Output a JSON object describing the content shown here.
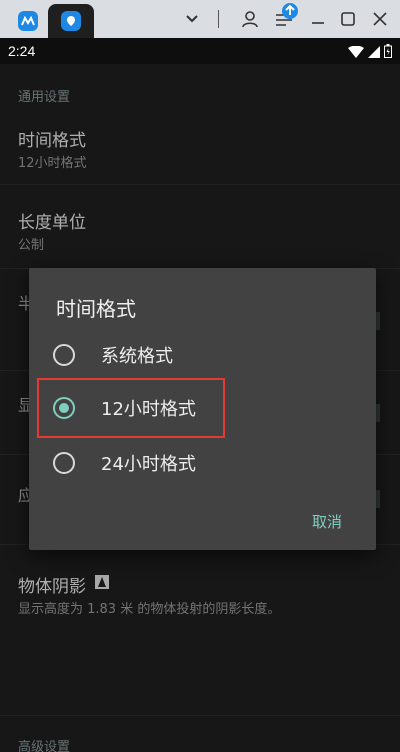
{
  "status_bar": {
    "time": "2:24"
  },
  "settings": {
    "section_general": "通用设置",
    "time_format": {
      "title": "时间格式",
      "value": "12小时格式"
    },
    "length_unit": {
      "title": "长度单位",
      "value": "公制"
    },
    "object_shadow": {
      "title": "物体阴影",
      "description": "显示高度为 1.83 米 的物体投射的阴影长度。"
    },
    "section_advanced": "高级设置"
  },
  "dialog": {
    "title": "时间格式",
    "options": [
      {
        "label": "系统格式",
        "selected": false
      },
      {
        "label": "12小时格式",
        "selected": true
      },
      {
        "label": "24小时格式",
        "selected": false
      }
    ],
    "cancel_label": "取消"
  },
  "colors": {
    "accent": "#7fcfc0",
    "highlight_box": "#e53935",
    "app_icon_blue": "#1e88e5"
  }
}
